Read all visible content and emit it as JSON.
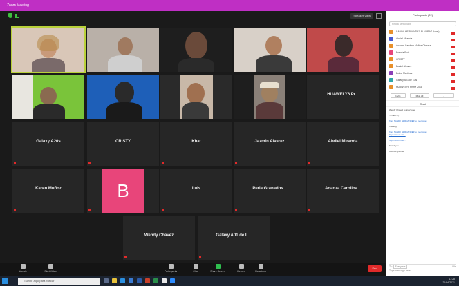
{
  "window": {
    "title": "Zoom Meeting"
  },
  "header": {
    "speaker_view": "Speaker View"
  },
  "tiles": [
    {
      "label": "",
      "name": ""
    },
    {
      "label": "",
      "name": ""
    },
    {
      "label": "",
      "name": ""
    },
    {
      "label": "",
      "name": ""
    },
    {
      "label": "",
      "name": ""
    },
    {
      "label": "",
      "name": ""
    },
    {
      "label": "",
      "name": ""
    },
    {
      "label": "",
      "name": ""
    },
    {
      "label": "",
      "name": ""
    },
    {
      "name": "HUAWEI Y6 Pr..."
    },
    {
      "name": "Galaxy A20s"
    },
    {
      "name": "CRISTY"
    },
    {
      "name": "Khat"
    },
    {
      "name": "Jazmín Alvarez"
    },
    {
      "name": "Abdiel Miranda"
    },
    {
      "name": "Karen Muñoz"
    },
    {
      "avatar": "B"
    },
    {
      "name": "Luis"
    },
    {
      "name": "Perla Granados..."
    },
    {
      "name": "Ananza Carolina..."
    },
    {
      "name": "Wendy Chavez"
    },
    {
      "name": "Galaxy A01 de L..."
    }
  ],
  "toolbar": {
    "unmute": "Unmute",
    "start_video": "Start Video",
    "participants": "Participants",
    "chat": "Chat",
    "share_screen": "Share Screen",
    "record": "Record",
    "reactions": "Reactions",
    "end": "End"
  },
  "sidebar": {
    "title": "Participants (22)",
    "search_placeholder": "Find a participant",
    "participants": [
      {
        "name": "SANDY HERNANDEZ ALMARAZ (Host)",
        "color": "#e8902a"
      },
      {
        "name": "Abdiel Miranda",
        "color": "#4a5bd1"
      },
      {
        "name": "Ananza Carolina Muñoz Chavez",
        "color": "#e8902a"
      },
      {
        "name": "Brenda Ruiz",
        "color": "#e8457a"
      },
      {
        "name": "CRISTY",
        "color": "#e8902a"
      },
      {
        "name": "Daniel Alvarez",
        "color": "#e8902a"
      },
      {
        "name": "Dulce Martínez",
        "color": "#8a3fb8"
      },
      {
        "name": "Galaxy A01 de Luis",
        "color": "#2fa8a8"
      },
      {
        "name": "HUAWEI Y6 Prime 2018",
        "color": "#e8902a"
      }
    ],
    "invite": "Invite",
    "mute_all": "Mute All",
    "more": "..."
  },
  "chat": {
    "title": "Chat",
    "messages": [
      {
        "from": "",
        "text": "Wendy Chavez to Everyone:"
      },
      {
        "from": "",
        "text": "Yo i leo (?)"
      },
      {
        "from": "from SANDY HERNANDEZ to Everyone:",
        "text": ""
      },
      {
        "from": "",
        "text": "meeting"
      },
      {
        "from": "from SANDY HERNANDEZ to Everyone:",
        "text": "",
        "link": "https://zoom.us/..."
      },
      {
        "from": "",
        "text": "",
        "link": "https://zoom.us/..."
      },
      {
        "from": "",
        "text": "Thank you"
      },
      {
        "from": "",
        "text": "Muchas gracias"
      }
    ],
    "to_label": "To:",
    "to_value": "Everyone",
    "file_label": "File",
    "placeholder": "Type message here..."
  },
  "taskbar": {
    "search_placeholder": "Escribe aquí para buscar",
    "time": "17:28",
    "date": "21/04/2021"
  }
}
